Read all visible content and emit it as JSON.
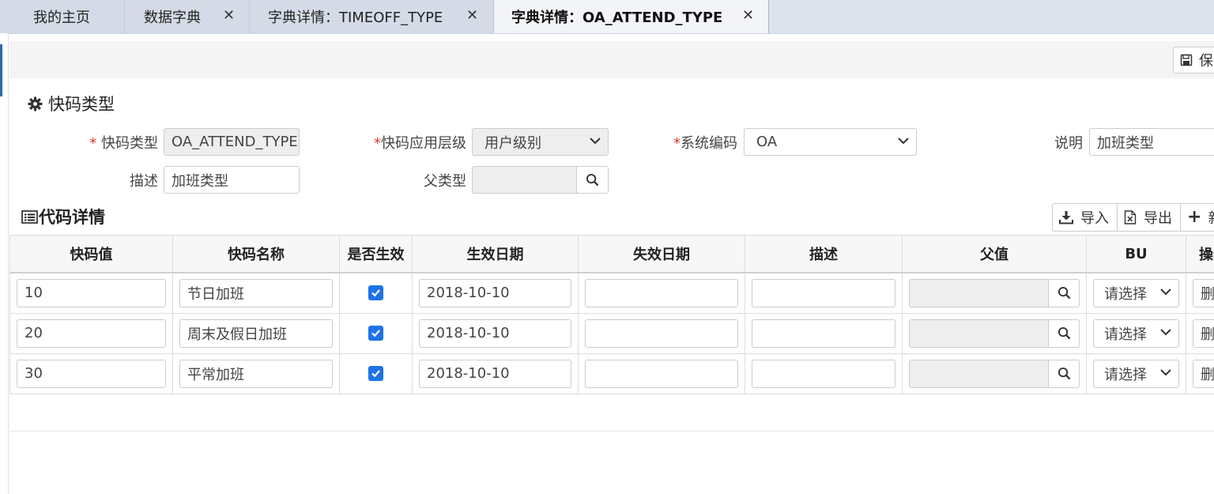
{
  "tabs": [
    {
      "label": "我的主页",
      "closable": false,
      "active": false
    },
    {
      "label": "数据字典",
      "closable": true,
      "active": false
    },
    {
      "label": "字典详情：TIMEOFF_TYPE",
      "closable": true,
      "active": false
    },
    {
      "label": "字典详情：OA_ATTEND_TYPE",
      "closable": true,
      "active": true
    }
  ],
  "toolbar": {
    "save_label": "保存"
  },
  "form": {
    "section_title": "快码类型",
    "fields": {
      "code_type": {
        "label": "快码类型",
        "required": true,
        "value": "OA_ATTEND_TYPE"
      },
      "apply_level": {
        "label": "快码应用层级",
        "required": true,
        "value": "用户级别"
      },
      "system_code": {
        "label": "系统编码",
        "required": true,
        "value": "OA"
      },
      "explain": {
        "label": "说明",
        "value": "加班类型"
      },
      "description": {
        "label": "描述",
        "value": "加班类型"
      },
      "parent_type": {
        "label": "父类型",
        "value": ""
      }
    }
  },
  "detail": {
    "section_title": "代码详情",
    "buttons": {
      "import": "导入",
      "export": "导出",
      "add": "新增"
    },
    "columns": [
      "快码值",
      "快码名称",
      "是否生效",
      "生效日期",
      "失效日期",
      "描述",
      "父值",
      "BU",
      "操作"
    ],
    "rows": [
      {
        "code": "10",
        "name": "节日加班",
        "enabled": true,
        "start_date": "2018-10-10",
        "end_date": "",
        "desc": "",
        "parent": "",
        "bu": "请选择",
        "action": "删除"
      },
      {
        "code": "20",
        "name": "周末及假日加班",
        "enabled": true,
        "start_date": "2018-10-10",
        "end_date": "",
        "desc": "",
        "parent": "",
        "bu": "请选择",
        "action": "删除"
      },
      {
        "code": "30",
        "name": "平常加班",
        "enabled": true,
        "start_date": "2018-10-10",
        "end_date": "",
        "desc": "",
        "parent": "",
        "bu": "请选择",
        "action": "删除"
      }
    ]
  },
  "colors": {
    "accent": "#1e73e8",
    "tabbar": "#dde3ed",
    "active_tab": "#f2f4f7",
    "required": "#dd3333"
  }
}
